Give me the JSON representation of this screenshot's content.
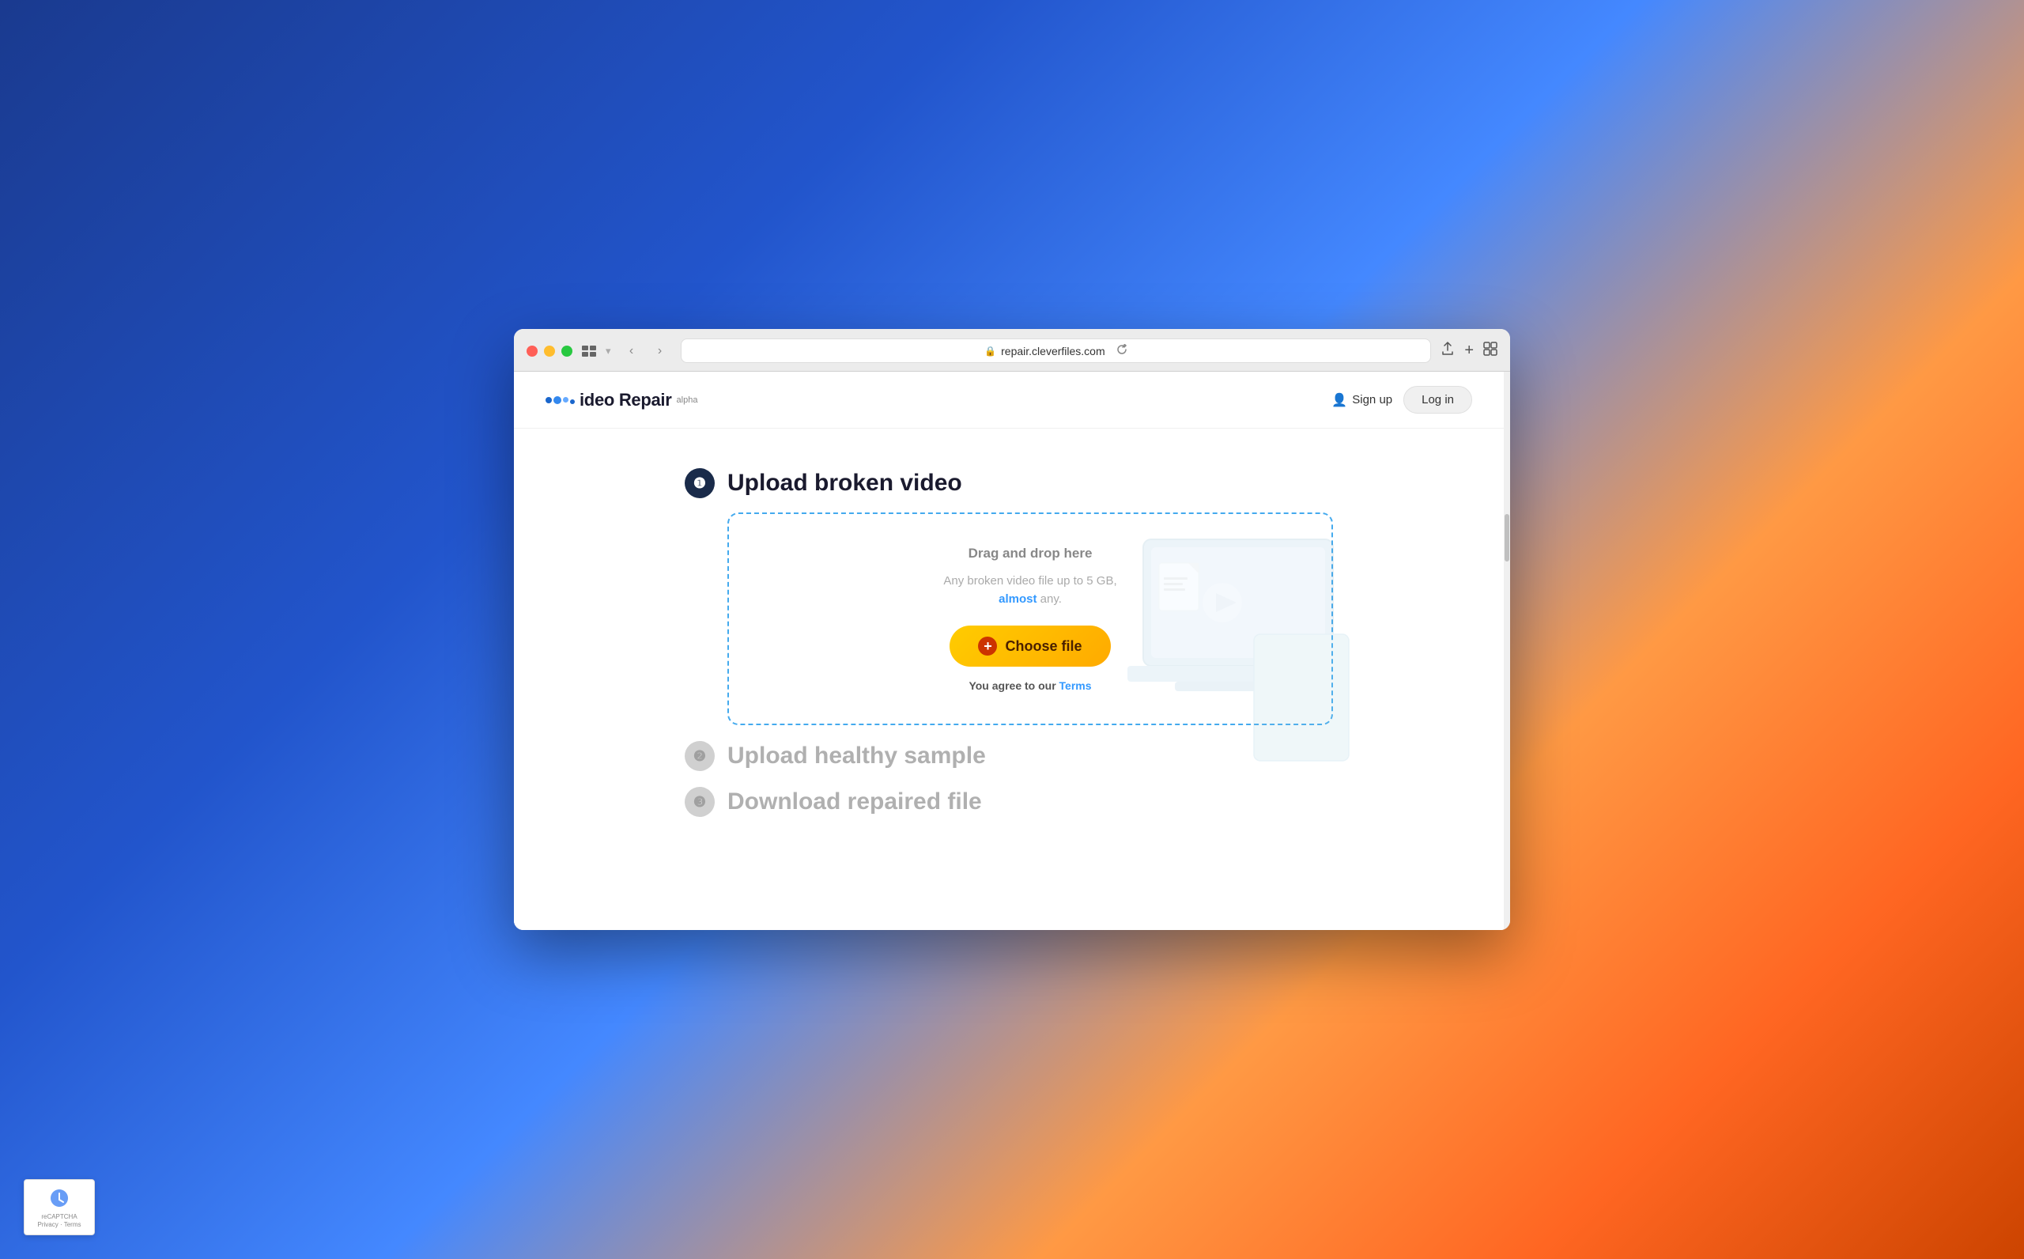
{
  "browser": {
    "url": "repair.cleverfiles.com",
    "tab_icon": "⊞",
    "back_arrow": "‹",
    "forward_arrow": "›",
    "refresh": "↻",
    "share": "⬆",
    "new_tab": "+",
    "tabs": "⧉"
  },
  "header": {
    "logo_text": "ideo Repair",
    "logo_alpha": "alpha",
    "signup_label": "Sign up",
    "login_label": "Log in"
  },
  "steps": {
    "step1": {
      "number": "❶",
      "title": "Upload broken video",
      "dropzone": {
        "drag_drop": "Drag and drop here",
        "subtitle_before": "Any broken video file up to 5 GB,",
        "subtitle_link": "almost",
        "subtitle_after": "any.",
        "choose_file_label": "Choose file",
        "terms_before": "You agree to our ",
        "terms_link": "Terms"
      }
    },
    "step2": {
      "number": "❷",
      "title": "Upload healthy sample"
    },
    "step3": {
      "number": "❸",
      "title": "Download repaired file"
    }
  },
  "recaptcha": {
    "privacy": "Privacy",
    "separator": "·",
    "terms": "Terms"
  },
  "colors": {
    "active_step_bg": "#1a2b4a",
    "inactive_step_bg": "#cccccc",
    "dropzone_border": "#44aaee",
    "choose_btn_gradient_start": "#ffcc00",
    "choose_btn_gradient_end": "#ffaa00",
    "plus_bg": "#cc3300",
    "link_color": "#3399ff"
  }
}
